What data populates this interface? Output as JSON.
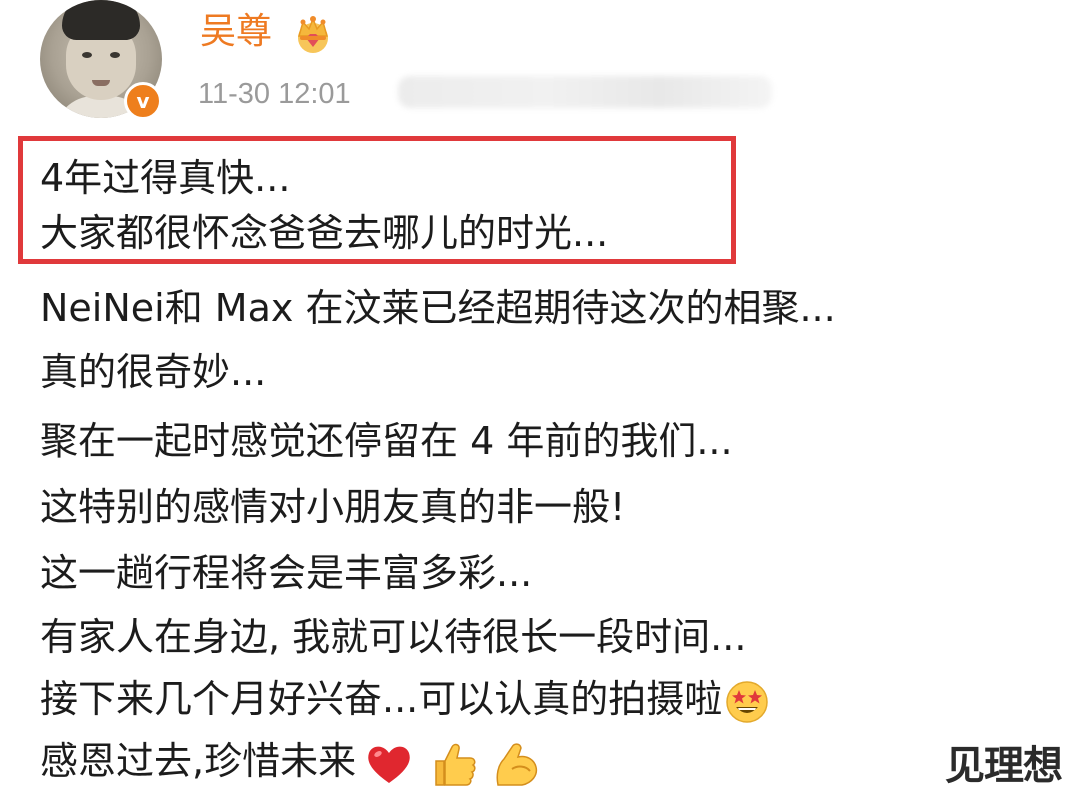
{
  "post": {
    "author": {
      "name": "吴尊",
      "verified_mark": "v",
      "avatar_icon": "child-portrait-avatar",
      "badge_icon": "crown-icon"
    },
    "timestamp": "11-30 12:01",
    "lines": [
      "4年过得真快...",
      "大家都很怀念爸爸去哪儿的时光...",
      "NeiNei和 Max 在汶莱已经超期待这次的相聚...",
      "真的很奇妙...",
      "聚在一起时感觉还停留在 4 年前的我们...",
      "这特别的感情对小朋友真的非一般!",
      "这一趟行程将会是丰富多彩...",
      "有家人在身边, 我就可以待很长一段时间...",
      "接下来几个月好兴奋...可以认真的拍摄啦",
      "感恩过去,珍惜未来"
    ],
    "emojis": {
      "line9": "star-struck-emoji",
      "line10": [
        "red-heart-emoji",
        "thumbs-up-emoji",
        "flexed-biceps-emoji"
      ]
    }
  },
  "watermark": "见理想",
  "colors": {
    "username": "#ee7a22",
    "verified_badge": "#ee7f1d",
    "highlight_border": "#e0393b",
    "timestamp": "#9a9a9a"
  }
}
